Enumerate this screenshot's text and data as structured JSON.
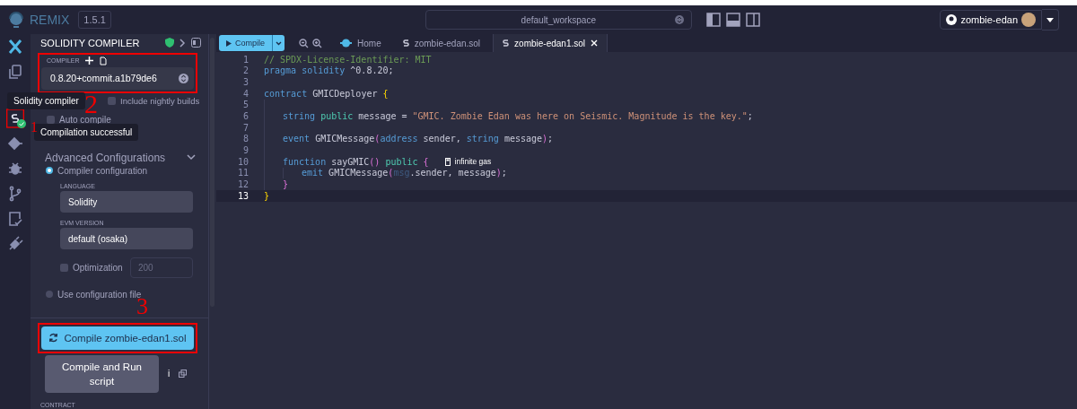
{
  "header": {
    "logo": "REMIX",
    "version": "1.5.1",
    "workspace": "default_workspace",
    "user": "zombie-edan"
  },
  "icon_bar": {
    "items": [
      {
        "kind": "ai",
        "selected": false,
        "highlighted": false
      },
      {
        "kind": "files",
        "selected": false,
        "highlighted": false
      },
      {
        "kind": "compiler",
        "selected": true,
        "highlighted": true
      },
      {
        "kind": "deploy",
        "selected": false,
        "highlighted": false
      },
      {
        "kind": "debug",
        "selected": false,
        "highlighted": false
      },
      {
        "kind": "git",
        "selected": false,
        "highlighted": false
      },
      {
        "kind": "tests",
        "selected": false,
        "highlighted": false
      },
      {
        "kind": "plugins",
        "selected": false,
        "highlighted": false
      }
    ]
  },
  "tooltips": [
    "Solidity compiler",
    "Compilation successful"
  ],
  "panel": {
    "title": "SOLIDITY COMPILER",
    "compiler_label": "COMPILER",
    "compiler_version": "0.8.20+commit.a1b79de6",
    "compiler_highlighted": true,
    "checkboxes": [
      {
        "label": "Include nightly builds",
        "checked": false
      },
      {
        "label": "Auto compile",
        "checked": false
      }
    ],
    "advanced": {
      "title": "Advanced Configurations",
      "expanded": true
    },
    "radios": [
      {
        "label": "Compiler configuration",
        "selected": true
      },
      {
        "label": "Use configuration file",
        "selected": false
      }
    ],
    "language": {
      "label": "LANGUAGE",
      "value": "Solidity"
    },
    "evm_version": {
      "label": "EVM VERSION",
      "value": "default (osaka)"
    },
    "optimization": {
      "label": "Optimization",
      "checked": false,
      "runs": "200"
    },
    "compile_button": {
      "label": "Compile zombie-edan1.sol",
      "highlighted": true
    },
    "run_button": "Compile and Run script",
    "info": "i",
    "contract_label": "CONTRACT"
  },
  "editor": {
    "compile_button": "Compile",
    "tabs": [
      {
        "kind": "home",
        "label": "Home",
        "selected": false
      },
      {
        "kind": "file",
        "label": "zombie-edan.sol",
        "selected": false
      },
      {
        "kind": "file",
        "label": "zombie-edan1.sol",
        "selected": true
      }
    ],
    "lines": [
      {
        "number": "1",
        "active": false,
        "tokens": [
          {
            "text": "// SPDX-License-Identifier: MIT",
            "kind": "comment"
          }
        ]
      },
      {
        "number": "2",
        "active": false,
        "tokens": [
          {
            "text": "pragma solidity",
            "kind": "keyword"
          },
          {
            "text": " ^0.8.20;",
            "kind": "plain"
          }
        ]
      },
      {
        "number": "3",
        "active": false
      },
      {
        "number": "4",
        "active": false,
        "tokens": [
          {
            "text": "contract",
            "kind": "keyword"
          },
          {
            "text": " GMICDeployer ",
            "kind": "plain"
          },
          {
            "text": "{",
            "kind": "brace"
          }
        ],
        "children": [
          {
            "number": "5",
            "active": false
          },
          {
            "number": "6",
            "active": false,
            "tokens": [
              {
                "text": "string",
                "kind": "keyword"
              },
              {
                "text": " public",
                "kind": "modifier"
              },
              {
                "text": " message = ",
                "kind": "plain"
              },
              {
                "text": "\"GMIC. Zombie Edan was here on Seismic. Magnitude is the key.\"",
                "kind": "string"
              },
              {
                "text": ";",
                "kind": "plain"
              }
            ]
          },
          {
            "number": "7",
            "active": false
          },
          {
            "number": "8",
            "active": false,
            "tokens": [
              {
                "text": "event",
                "kind": "keyword"
              },
              {
                "text": " GMICMessage",
                "kind": "plain"
              },
              {
                "text": "(",
                "kind": "paren"
              },
              {
                "text": "address",
                "kind": "keyword"
              },
              {
                "text": " sender, ",
                "kind": "plain"
              },
              {
                "text": "string",
                "kind": "keyword"
              },
              {
                "text": " message",
                "kind": "plain"
              },
              {
                "text": ")",
                "kind": "paren"
              },
              {
                "text": ";",
                "kind": "plain"
              }
            ]
          },
          {
            "number": "9",
            "active": false
          },
          {
            "number": "10",
            "active": false,
            "gas": "infinite gas",
            "tokens": [
              {
                "text": "function",
                "kind": "keyword"
              },
              {
                "text": " sayGMIC",
                "kind": "plain"
              },
              {
                "text": "()",
                "kind": "paren"
              },
              {
                "text": " public",
                "kind": "modifier"
              },
              {
                "text": " {",
                "kind": "paren"
              }
            ],
            "children": [
              {
                "number": "11",
                "active": false,
                "tokens": [
                  {
                    "text": "emit",
                    "kind": "keyword"
                  },
                  {
                    "text": " GMICMessage",
                    "kind": "plain"
                  },
                  {
                    "text": "(",
                    "kind": "paren"
                  },
                  {
                    "text": "msg",
                    "kind": "dim"
                  },
                  {
                    "text": ".sender, message",
                    "kind": "plain"
                  },
                  {
                    "text": ")",
                    "kind": "paren"
                  },
                  {
                    "text": ";",
                    "kind": "plain"
                  }
                ]
              }
            ]
          },
          {
            "number": "12",
            "active": false,
            "tokens": [
              {
                "text": "}",
                "kind": "paren"
              }
            ]
          }
        ]
      },
      {
        "number": "13",
        "active": true,
        "tokens": [
          {
            "text": "}",
            "kind": "brace"
          }
        ]
      }
    ]
  },
  "annotations": [
    {
      "label": "2"
    },
    {
      "label": "1"
    },
    {
      "label": "3"
    }
  ]
}
